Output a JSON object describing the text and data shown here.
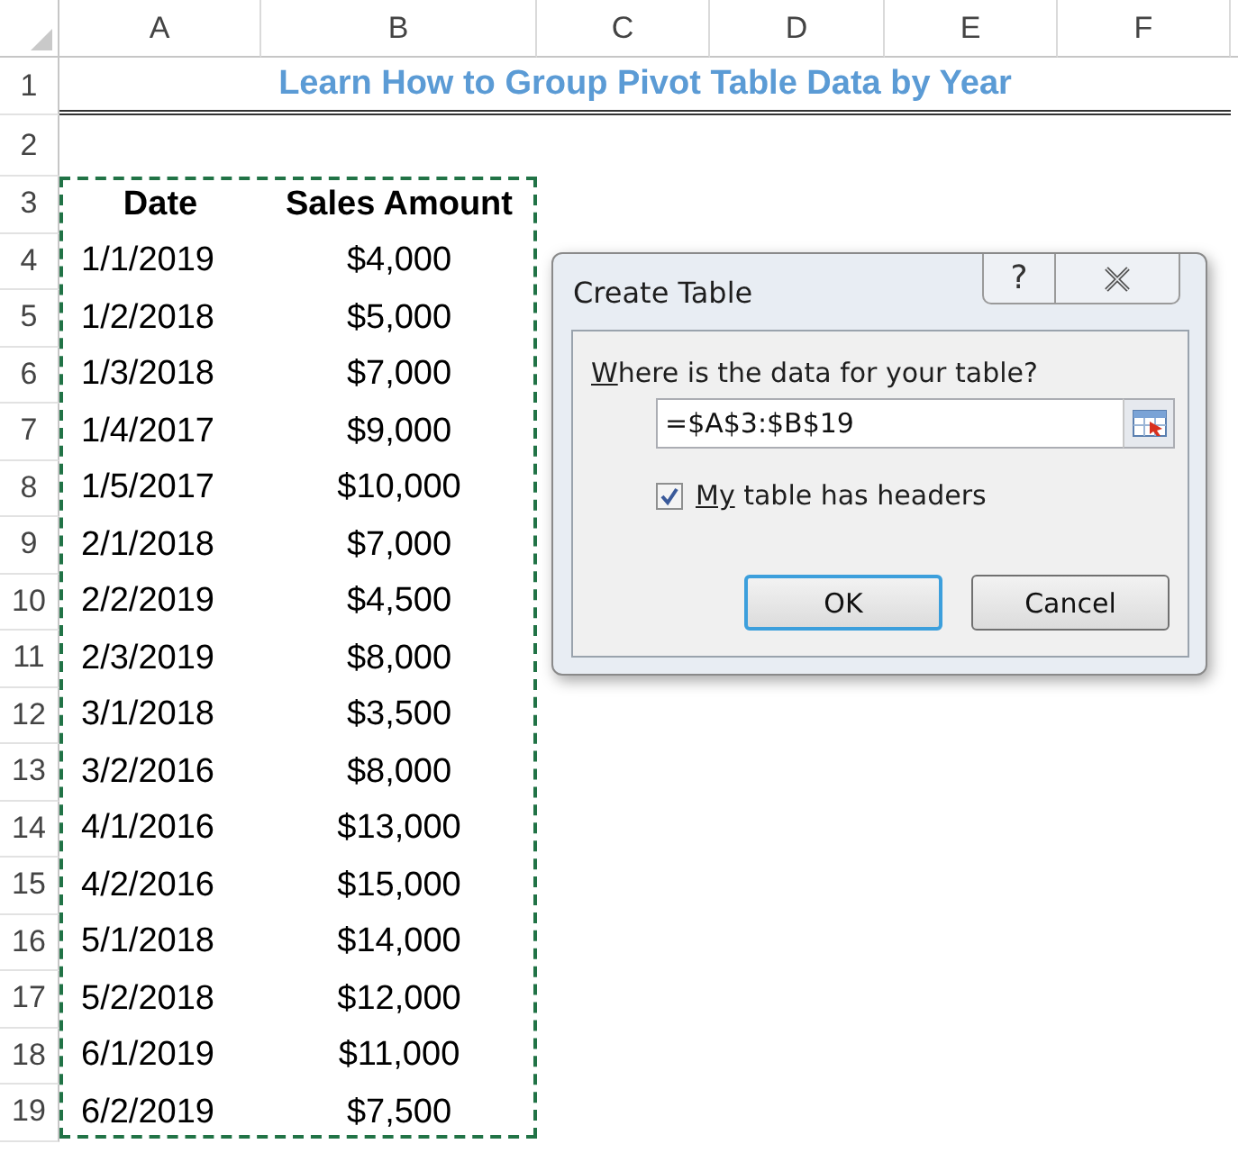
{
  "sheet": {
    "columns": [
      "A",
      "B",
      "C",
      "D",
      "E",
      "F"
    ],
    "row_numbers": [
      "1",
      "2",
      "3",
      "4",
      "5",
      "6",
      "7",
      "8",
      "9",
      "10",
      "11",
      "12",
      "13",
      "14",
      "15",
      "16",
      "17",
      "18",
      "19"
    ],
    "title": "Learn How to Group Pivot Table Data by Year",
    "headers": [
      "Date",
      "Sales Amount"
    ],
    "rows": [
      {
        "date": "1/1/2019",
        "amount": "$4,000"
      },
      {
        "date": "1/2/2018",
        "amount": "$5,000"
      },
      {
        "date": "1/3/2018",
        "amount": "$7,000"
      },
      {
        "date": "1/4/2017",
        "amount": "$9,000"
      },
      {
        "date": "1/5/2017",
        "amount": "$10,000"
      },
      {
        "date": "2/1/2018",
        "amount": "$7,000"
      },
      {
        "date": "2/2/2019",
        "amount": "$4,500"
      },
      {
        "date": "2/3/2019",
        "amount": "$8,000"
      },
      {
        "date": "3/1/2018",
        "amount": "$3,500"
      },
      {
        "date": "3/2/2016",
        "amount": "$8,000"
      },
      {
        "date": "4/1/2016",
        "amount": "$13,000"
      },
      {
        "date": "4/2/2016",
        "amount": "$15,000"
      },
      {
        "date": "5/1/2018",
        "amount": "$14,000"
      },
      {
        "date": "5/2/2018",
        "amount": "$12,000"
      },
      {
        "date": "6/1/2019",
        "amount": "$11,000"
      },
      {
        "date": "6/2/2019",
        "amount": "$7,500"
      }
    ]
  },
  "dialog": {
    "title": "Create Table",
    "help_button": "?",
    "range_label": {
      "access_key": "W",
      "rest": "here is the data for your table?"
    },
    "range_field": {
      "value": "=$A$3:$B$19"
    },
    "headers_checkbox": {
      "access_key": "My",
      "rest": " table has headers",
      "checked": true
    },
    "buttons": [
      {
        "label": "OK",
        "default": true
      },
      {
        "label": "Cancel",
        "default": false
      }
    ]
  }
}
